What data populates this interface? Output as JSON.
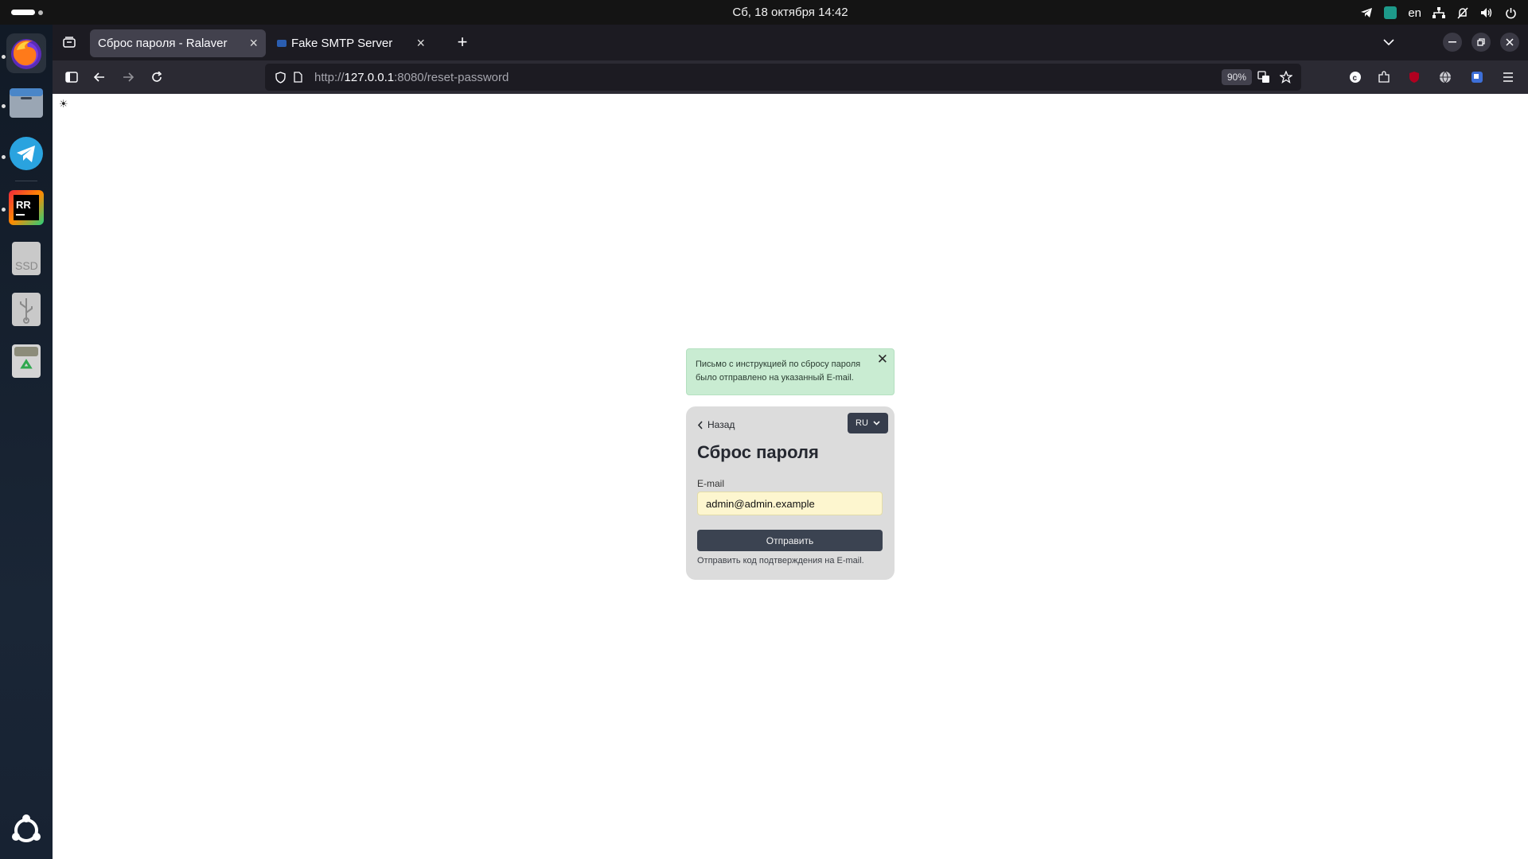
{
  "system": {
    "datetime": "Сб, 18 октября  14:42",
    "keyboard_layout": "en",
    "tray_icons": [
      "telegram-tray-icon",
      "app-tray-icon",
      "network-icon",
      "notifications-off-icon",
      "volume-icon",
      "power-icon"
    ]
  },
  "dock": {
    "items": [
      "firefox-icon",
      "files-icon",
      "telegram-icon",
      "rustrover-icon",
      "ssd-drive-icon",
      "usb-drive-icon",
      "trash-icon",
      "show-apps-icon"
    ],
    "ssd_label": "SSD",
    "rustrover_label": "RR"
  },
  "browser": {
    "tabs": [
      {
        "title": "Сброс пароля - Ralaver",
        "active": true
      },
      {
        "title": "Fake SMTP Server",
        "active": false
      }
    ],
    "url_scheme": "http://",
    "url_host": "127.0.0.1",
    "url_rest": ":8080/reset-password",
    "zoom": "90%"
  },
  "page": {
    "alert_text": "Письмо с инструкцией по сбросу пароля было отправлено на указанный E-mail.",
    "back_label": "Назад",
    "lang_label": "RU",
    "title": "Сброс пароля",
    "email_label": "E-mail",
    "email_value": "admin@admin.example",
    "submit_label": "Отправить",
    "hint": "Отправить код подтверждения на E-mail."
  },
  "colors": {
    "alert_bg": "#c9ecd2",
    "card_bg": "#dcdcdc",
    "button_bg": "#3b4351",
    "input_bg": "#fdf6cf"
  }
}
